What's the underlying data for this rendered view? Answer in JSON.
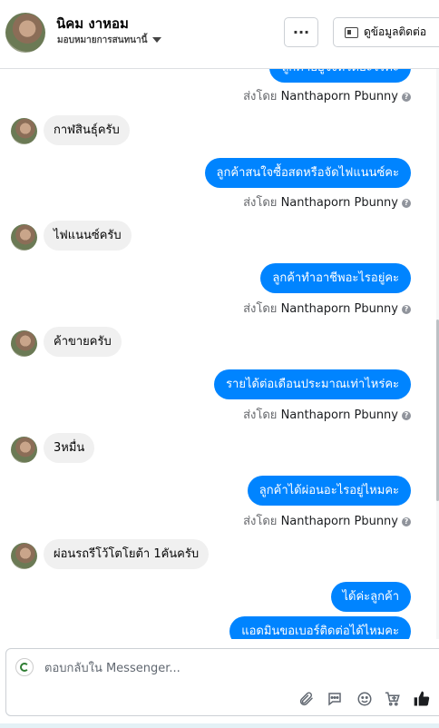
{
  "header": {
    "contact_name": "นิคม งาหอม",
    "assignee_label": "มอบหมายการสนทนานี้",
    "more_label": "···",
    "view_contact_label": "ดูข้อมูลติดต่อ"
  },
  "messages": [
    {
      "dir": "out",
      "text": "ลูกค้าอยู่จังหวัดอะไรคะ"
    },
    {
      "dir": "out_meta",
      "prefix": "ส่งโดย",
      "sender": "Nanthaporn Pbunny"
    },
    {
      "dir": "in",
      "text": "กาฬสินธุ์ครับ"
    },
    {
      "dir": "out",
      "text": "ลูกค้าสนใจซื้อสดหรือจัดไฟแนนซ์คะ"
    },
    {
      "dir": "out_meta",
      "prefix": "ส่งโดย",
      "sender": "Nanthaporn Pbunny"
    },
    {
      "dir": "in",
      "text": "ไฟแนนซ์ครับ"
    },
    {
      "dir": "out",
      "text": "ลูกค้าทำอาชีพอะไรอยู่คะ"
    },
    {
      "dir": "out_meta",
      "prefix": "ส่งโดย",
      "sender": "Nanthaporn Pbunny"
    },
    {
      "dir": "in",
      "text": "ค้าขายครับ"
    },
    {
      "dir": "out",
      "text": "รายได้ต่อเดือนประมาณเท่าไหร่คะ"
    },
    {
      "dir": "out_meta",
      "prefix": "ส่งโดย",
      "sender": "Nanthaporn Pbunny"
    },
    {
      "dir": "in",
      "text": "3หมื่น"
    },
    {
      "dir": "out",
      "text": "ลูกค้าได้ผ่อนอะไรอยู่ไหมคะ"
    },
    {
      "dir": "out_meta",
      "prefix": "ส่งโดย",
      "sender": "Nanthaporn Pbunny"
    },
    {
      "dir": "in",
      "text": "ผ่อนรถรีโว้โตโยต้า 1คันครับ"
    },
    {
      "dir": "out",
      "text": "ได้ค่ะลูกค้า"
    },
    {
      "dir": "out",
      "text": "แอดมินขอเบอร์ติดต่อได้ไหมคะ"
    }
  ],
  "composer": {
    "placeholder": "ตอบกลับใน Messenger...",
    "tools": [
      "paperclip-icon",
      "speech-bubble-icon",
      "emoji-icon",
      "cart-icon",
      "thumbs-up-icon"
    ]
  },
  "colors": {
    "outgoing_bubble": "#0084ff",
    "incoming_bubble": "#f0f0f0",
    "like_icon": "#1c1e21"
  }
}
